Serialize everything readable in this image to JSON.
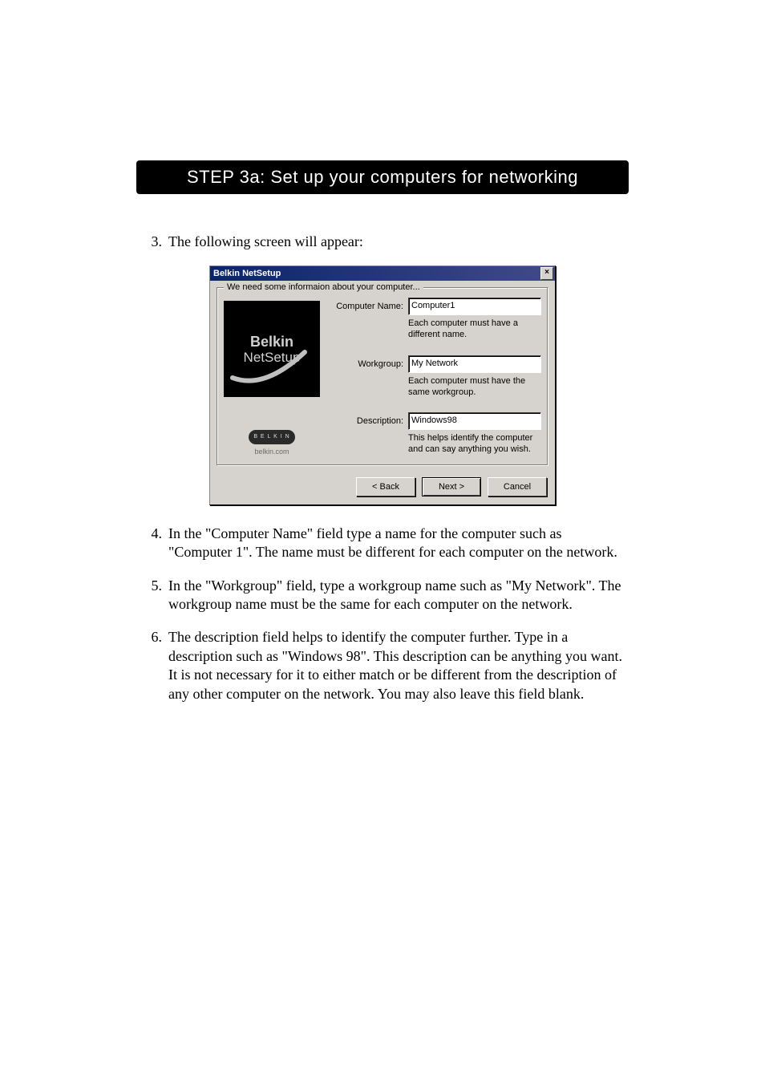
{
  "header": {
    "step_title": "STEP 3a: Set up your computers for networking"
  },
  "steps_above": [
    {
      "num": "3.",
      "text": "The following screen will appear:"
    }
  ],
  "dialog": {
    "title": "Belkin NetSetup",
    "close_glyph": "×",
    "group_label": "We need some informaion about your computer...",
    "brand_line1": "Belkin",
    "brand_line2": "NetSetup",
    "brand_pill": "B E L K I N",
    "brand_url": "belkin.com",
    "fields": {
      "computer_name": {
        "label": "Computer Name:",
        "value": "Computer1",
        "hint": "Each computer must have a different name."
      },
      "workgroup": {
        "label": "Workgroup:",
        "value": "My Network",
        "hint": "Each computer must have the same workgroup."
      },
      "description": {
        "label": "Description:",
        "value": "Windows98",
        "hint": "This helps identify the computer and can say anything you wish."
      }
    },
    "buttons": {
      "back": "< Back",
      "next": "Next >",
      "cancel": "Cancel"
    }
  },
  "steps_below": [
    {
      "num": "4.",
      "text": "In the \"Computer Name\" field type a name for the computer such as \"Computer 1\". The name must be different for each computer on the network."
    },
    {
      "num": "5.",
      "text": "In the \"Workgroup\" field, type a workgroup name such as \"My Network\". The workgroup name must be the same for each computer on the network."
    },
    {
      "num": "6.",
      "text": "The description field helps to identify the computer further. Type in a description such as \"Windows 98\". This description can be anything you want. It is not necessary for it to either match or be different from the description of any other computer on the network. You may also leave this field blank."
    }
  ]
}
